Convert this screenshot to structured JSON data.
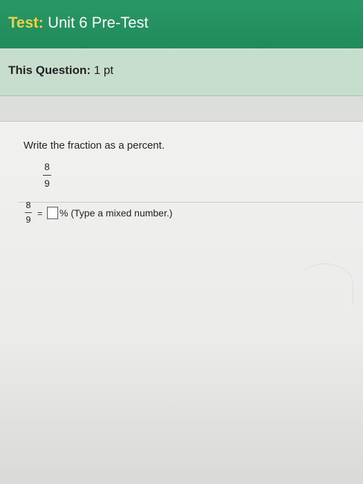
{
  "header": {
    "test_label": "Test:",
    "test_name": "Unit 6 Pre-Test"
  },
  "question_bar": {
    "label": "This Question:",
    "points": "1 pt"
  },
  "question": {
    "instruction": "Write the fraction as a percent.",
    "fraction": {
      "numerator": "8",
      "denominator": "9"
    },
    "answer": {
      "numerator": "8",
      "denominator": "9",
      "equals": "=",
      "value": "",
      "percent_hint": "% (Type a mixed number.)"
    }
  },
  "colors": {
    "header_bg": "#2a9866",
    "header_accent": "#e8d24a",
    "question_bar_bg": "#c7ddcd"
  }
}
